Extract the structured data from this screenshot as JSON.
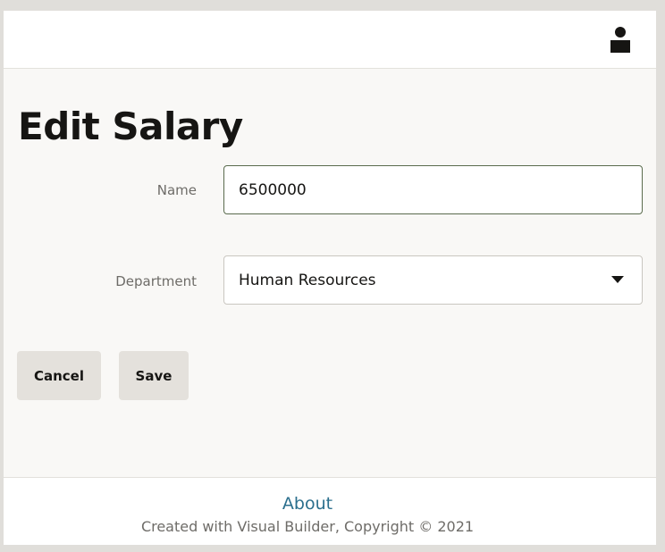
{
  "page": {
    "title": "Edit Salary"
  },
  "form": {
    "name_label": "Name",
    "name_value": "6500000",
    "department_label": "Department",
    "department_value": "Human Resources"
  },
  "actions": {
    "cancel_label": "Cancel",
    "save_label": "Save"
  },
  "footer": {
    "about_label": "About",
    "copyright": "Created with Visual Builder, Copyright © 2021"
  },
  "icons": {
    "user": "user-icon",
    "dropdown": "chevron-down-icon"
  },
  "colors": {
    "link": "#2b6f8d",
    "input_focus_border": "#5a6b4d",
    "button_bg": "#e4e1dc"
  }
}
